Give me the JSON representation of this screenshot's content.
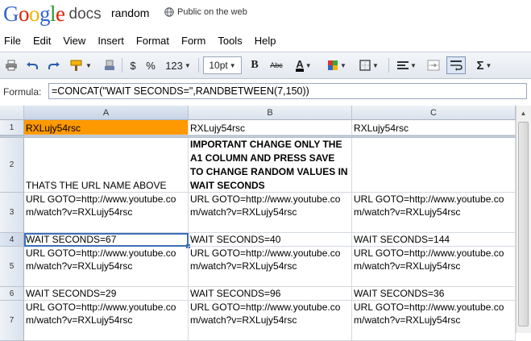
{
  "header": {
    "logo_letters": [
      "G",
      "o",
      "o",
      "g",
      "l",
      "e"
    ],
    "logo_colors": [
      "#3366cc",
      "#dd2200",
      "#f2b300",
      "#3366cc",
      "#2a9d2a",
      "#dd2200"
    ],
    "product": "docs",
    "doc_title": "random",
    "visibility": "Public on the web",
    "visibility_icon": "globe-icon"
  },
  "menu": [
    "File",
    "Edit",
    "View",
    "Insert",
    "Format",
    "Form",
    "Tools",
    "Help"
  ],
  "toolbar": {
    "currency": "$",
    "percent": "%",
    "number_format": "123",
    "font_size": "10pt",
    "bold": "B",
    "strike": "Abc",
    "text_color": "A",
    "functions": "Σ",
    "icons": [
      "print-icon",
      "undo-icon",
      "redo-icon",
      "format-painter-icon",
      "clear-format-icon",
      "bold-icon",
      "strikethrough-icon",
      "text-color-icon",
      "fill-color-icon",
      "borders-icon",
      "align-icon",
      "merge-icon",
      "wrap-icon",
      "functions-icon"
    ]
  },
  "formula": {
    "label": "Formula:",
    "value": "=CONCAT(\"WAIT SECONDS=\",RANDBETWEEN(7,150))"
  },
  "grid": {
    "columns": [
      "A",
      "B",
      "C"
    ],
    "rows": [
      "1",
      "2",
      "3",
      "4",
      "5",
      "6",
      "7"
    ],
    "selected_cell": "A4",
    "cells": {
      "A1": "RXLujy54rsc",
      "B1": "RXLujy54rsc",
      "C1": "RXLujy54rsc",
      "A2": "THATS THE URL NAME ABOVE",
      "B2": "IMPORTANT CHANGE ONLY THE A1 COLUMN AND PRESS SAVE TO CHANGE RANDOM VALUES IN WAIT SECONDS",
      "C2": "",
      "A3": "URL GOTO=http://www.youtube.com/watch?v=RXLujy54rsc",
      "B3": "URL GOTO=http://www.youtube.com/watch?v=RXLujy54rsc",
      "C3": "URL GOTO=http://www.youtube.com/watch?v=RXLujy54rsc",
      "A4": "WAIT SECONDS=67",
      "B4": "WAIT SECONDS=40",
      "C4": "WAIT SECONDS=144",
      "A5": "URL GOTO=http://www.youtube.com/watch?v=RXLujy54rsc",
      "B5": "URL GOTO=http://www.youtube.com/watch?v=RXLujy54rsc",
      "C5": "URL GOTO=http://www.youtube.com/watch?v=RXLujy54rsc",
      "A6": "WAIT SECONDS=29",
      "B6": "WAIT SECONDS=96",
      "C6": "WAIT SECONDS=36",
      "A7": "URL GOTO=http://www.youtube.com/watch?v=RXLujy54rsc",
      "B7": "URL GOTO=http://www.youtube.com/watch?v=RXLujy54rsc",
      "C7": "URL GOTO=http://www.youtube.com/watch?v=RXLujy54rsc"
    },
    "highlight_color": "#ff9900"
  }
}
